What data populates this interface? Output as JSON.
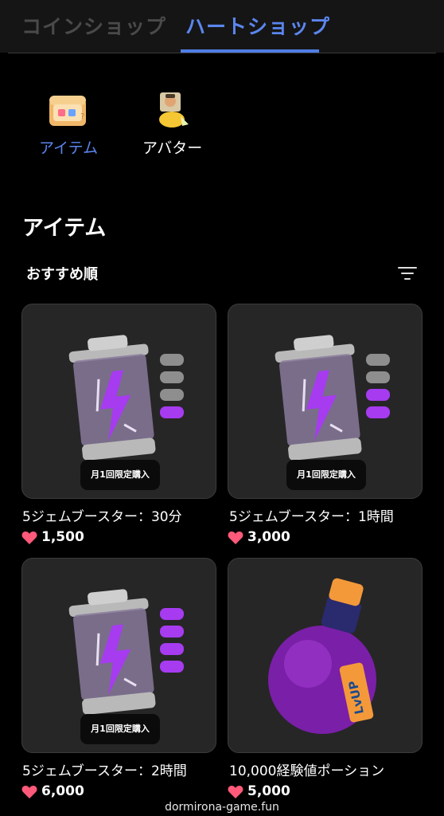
{
  "tabs": {
    "coin_shop": "コインショップ",
    "heart_shop": "ハートショップ"
  },
  "categories": {
    "items_label": "アイテム",
    "avatar_label": "アバター"
  },
  "section": {
    "title": "アイテム",
    "sort_label": "おすすめ順"
  },
  "products": [
    {
      "name": "5ジェムブースター：30分",
      "price": "1,500",
      "badge": "月1回限定購入"
    },
    {
      "name": "5ジェムブースター：1時間",
      "price": "3,000",
      "badge": "月1回限定購入"
    },
    {
      "name": "5ジェムブースター：2時間",
      "price": "6,000",
      "badge": "月1回限定購入"
    },
    {
      "name": "10,000経験値ポーション",
      "price": "5,000"
    }
  ],
  "potion_tag_text": "LvUP",
  "watermark": "dormirona-game.fun",
  "colors": {
    "accent": "#4f7ee6",
    "inactive_tab": "#4a4a4a",
    "card_bg": "#262626",
    "heart": "#ff5a7a",
    "booster_purple": "#a63bf0"
  }
}
